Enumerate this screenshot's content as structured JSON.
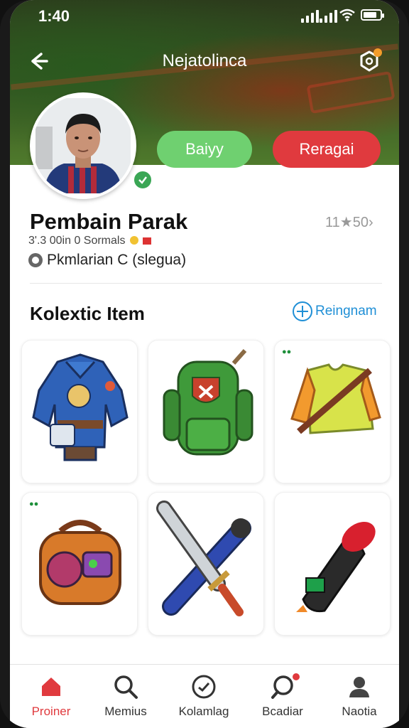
{
  "status_bar": {
    "time": "1:40"
  },
  "header": {
    "title": "Nejatolinca"
  },
  "profile": {
    "name": "Pembain Parak",
    "level": "11★50›",
    "stats": "3'.3 00in 0 Sormals",
    "club": "Pkmlarian C (slegua)"
  },
  "actions": {
    "buy_label": "Baiyy",
    "trade_label": "Reragai"
  },
  "collection": {
    "title": "Kolextic Item",
    "add_label": "Reingnam",
    "items": [
      {
        "name": "blue-jacket-item"
      },
      {
        "name": "green-backpack-item"
      },
      {
        "name": "yellow-vest-item"
      },
      {
        "name": "orange-bag-item"
      },
      {
        "name": "sword-bat-item"
      },
      {
        "name": "black-grenade-item"
      }
    ]
  },
  "tabs": [
    {
      "label": "Proiner",
      "icon": "home-icon",
      "active": true
    },
    {
      "label": "Memius",
      "icon": "search-icon",
      "active": false
    },
    {
      "label": "Kolamlag",
      "icon": "clock-icon",
      "active": false
    },
    {
      "label": "Bcadiar",
      "icon": "chat-icon",
      "active": false
    },
    {
      "label": "Naotia",
      "icon": "person-icon",
      "active": false
    }
  ],
  "colors": {
    "accent_green": "#6fd070",
    "accent_red": "#e03a3e",
    "link_blue": "#1f8fd6"
  }
}
